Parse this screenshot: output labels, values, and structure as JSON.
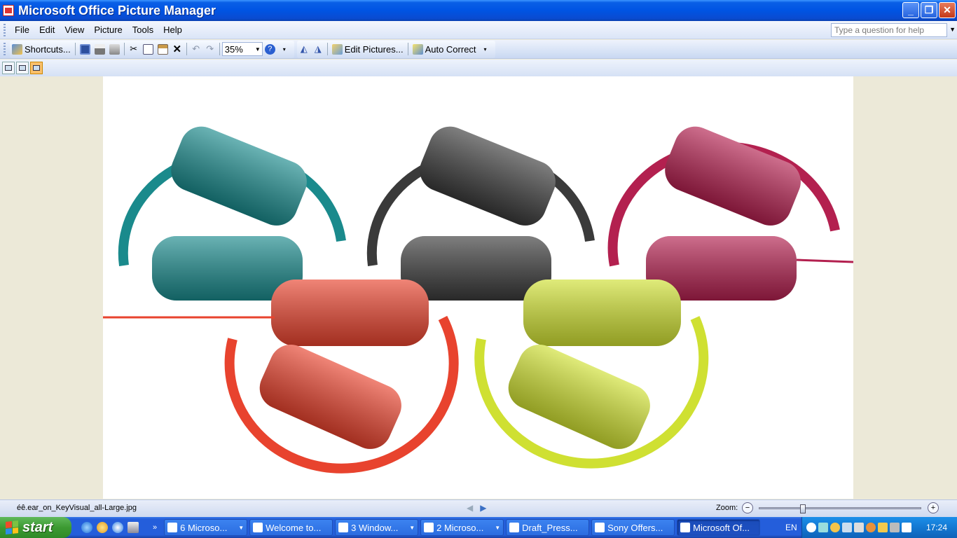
{
  "window": {
    "title": "Microsoft Office Picture Manager"
  },
  "menubar": {
    "items": [
      "File",
      "Edit",
      "View",
      "Picture",
      "Tools",
      "Help"
    ],
    "help_placeholder": "Type a question for help"
  },
  "toolbar": {
    "shortcuts_label": "Shortcuts...",
    "zoom_value": "35%",
    "edit_pictures_label": "Edit Pictures...",
    "auto_correct_label": "Auto Correct"
  },
  "statusbar": {
    "filename": "éê.ear_on_KeyVisual_all-Large.jpg",
    "zoom_label": "Zoom:",
    "zoom_slider_fraction": 0.26
  },
  "picture": {
    "headphone_colors": [
      "#1a8a8c",
      "#3a3a3a",
      "#b3204f",
      "#e8432e",
      "#cfe032"
    ]
  },
  "taskbar": {
    "start_label": "start",
    "tasks": [
      {
        "label": "6 Microso...",
        "has_arrow": true
      },
      {
        "label": "Welcome to...",
        "has_arrow": false
      },
      {
        "label": "3 Window...",
        "has_arrow": true
      },
      {
        "label": "2 Microso...",
        "has_arrow": true
      },
      {
        "label": "Draft_Press...",
        "has_arrow": false
      },
      {
        "label": "Sony Offers...",
        "has_arrow": false
      },
      {
        "label": "Microsoft Of...",
        "has_arrow": false,
        "active": true
      }
    ],
    "language": "EN",
    "clock": "17:24"
  }
}
